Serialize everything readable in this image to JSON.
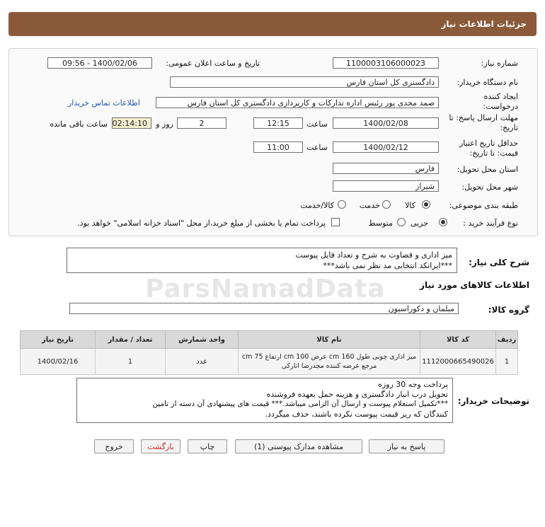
{
  "header": {
    "title": "جزئیات اطلاعات نیاز"
  },
  "form": {
    "need_number_label": "شماره نیاز:",
    "need_number": "1100003106000023",
    "announce_label": "تاریخ و ساعت اعلان عمومی:",
    "announce_value": "1400/02/06 - 09:56",
    "buyer_label": "نام دستگاه خریدار:",
    "buyer_value": "دادگستری کل استان فارس",
    "creator_label": "ایجاد کننده درخواست:",
    "creator_value": "صمد مجدی پور رئیس اداره تدارکات و کارپردازی دادگستری کل استان فارس",
    "contact_link": "اطلاعات تماس خریدار",
    "deadline_label": "مهلت ارسال پاسخ: تا تاریخ:",
    "deadline_date": "1400/02/08",
    "time_label": "ساعت",
    "deadline_time": "12:15",
    "days_value": "2",
    "days_label": "روز و",
    "remaining_time": "02:14:10",
    "remaining_label": "ساعت باقی مانده",
    "validity_label": "حداقل تاریخ اعتبار قیمت: تا تاریخ:",
    "validity_date": "1400/02/12",
    "validity_time_label": "ساعت",
    "validity_time": "11:00",
    "province_label": "استان محل تحویل:",
    "province_value": "فارس",
    "city_label": "شهر محل تحویل:",
    "city_value": "شیراز",
    "category_label": "طبقه بندی موضوعی:",
    "category_options": [
      "کالا",
      "خدمت",
      "کالا/خدمت"
    ],
    "category_selected": "کالا",
    "process_label": "نوع فرآیند خرید :",
    "process_options": [
      "جزیی",
      "متوسط"
    ],
    "process_selected": "جزیی",
    "payment_text": "پرداخت تمام یا بخشی از مبلغ خرید،از محل \"اسناد خزانه اسلامی\" خواهد بود."
  },
  "description": {
    "label": "شرح کلی نیاز:",
    "line1": "میز اداری و قضاوت به شرح و تعداد فایل پیوست",
    "line2": "***ایرانکد انتخابی مد نظر نمی باشد***"
  },
  "goods_section": {
    "title": "اطلاعات کالاهای مورد نیاز"
  },
  "group": {
    "label": "گروه کالا:",
    "value": "مبلمان و دکوراسیون"
  },
  "table": {
    "headers": [
      "ردیف",
      "کد کالا",
      "نام کالا",
      "واحد شمارش",
      "تعداد / مقدار",
      "تاریخ نیاز"
    ],
    "rows": [
      {
        "row": "1",
        "code": "1112000665490026",
        "name_line1": "میز اداری چوبی طول cm 160 عرض cm 100 ارتفاع cm 75",
        "name_line2": "مرجع عرضه کننده مجدرضا اتارکی",
        "unit": "عدد",
        "qty": "1",
        "date": "1400/02/16"
      }
    ]
  },
  "buyer_notes": {
    "label": "توضیحات خریدار:",
    "line1": "پرداخت وجه 30 روزه",
    "line2": "تحویل درب انبار دادگستری و هزینه حمل بعهده فروشنده",
    "line3": "***تکمیل استعلام پیوست و ارسال آن الزامی میباشد.*** قیمت های پیشنهادی آن دسته از تامین",
    "line4": "کنندگان که ریز قیمت پیوست نکرده باشند، حذف میگردد."
  },
  "buttons": {
    "reply": "پاسخ به نیاز",
    "attachments": "مشاهده مدارک پیوستی (1)",
    "print": "چاپ",
    "back": "بازگشت",
    "exit": "خروج"
  },
  "watermark": "ParsNamadData",
  "colors": {
    "header_bg": "#8b5a3a",
    "timer_bg": "#f4efcf",
    "link": "#2255aa"
  }
}
